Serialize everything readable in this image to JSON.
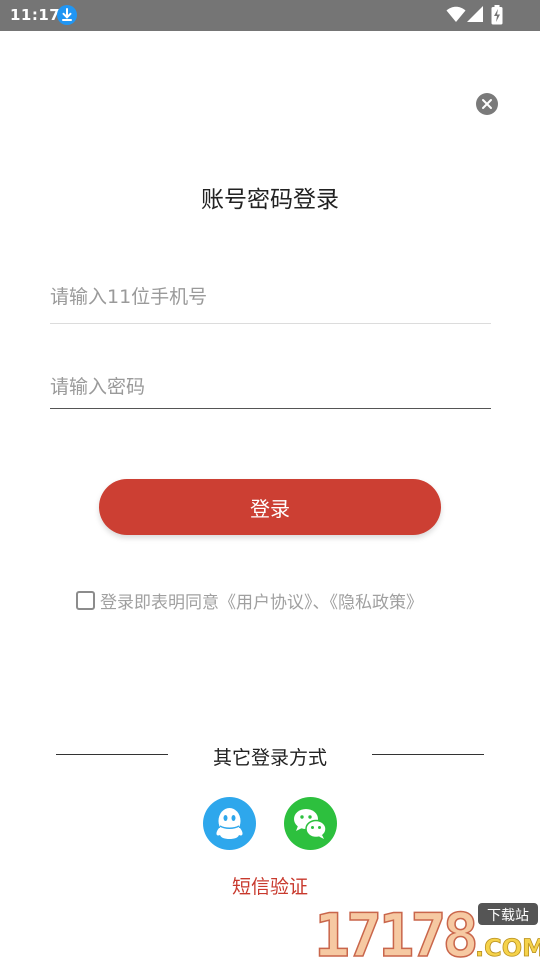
{
  "status_bar": {
    "time": "11:17",
    "icons": [
      "download-icon",
      "wifi-icon",
      "signal-icon",
      "battery-charging-icon"
    ]
  },
  "login": {
    "title": "账号密码登录",
    "phone_placeholder": "请输入11位手机号",
    "phone_value": "",
    "password_placeholder": "请输入密码",
    "password_value": "",
    "login_button_label": "登录",
    "agreement_text": "登录即表明同意《用户协议》、《隐私政策》",
    "agreement_checked": false
  },
  "other_login": {
    "label": "其它登录方式",
    "methods": [
      "qq-icon",
      "wechat-icon"
    ],
    "sms_link": "短信验证"
  },
  "watermark": {
    "logo_text": "17178",
    "badge_text": "下载站",
    "suffix_text": ".COM"
  },
  "colors": {
    "status_bar": "#757575",
    "primary_red": "#cc3f33",
    "qq_blue": "#2ea7ec",
    "wechat_green": "#2dc03e",
    "placeholder_gray": "#9a9a9a"
  }
}
